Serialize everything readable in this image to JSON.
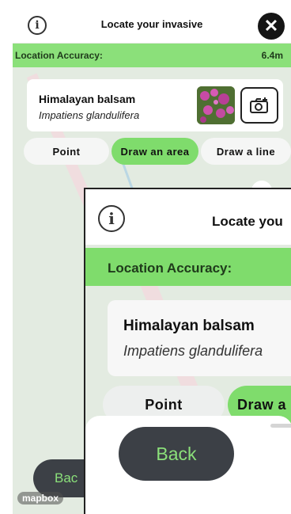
{
  "header": {
    "title": "Locate your invasive",
    "info_icon": "info-icon",
    "close_icon": "close-icon"
  },
  "accuracy": {
    "label": "Location Accuracy:",
    "value": "6.4m",
    "color": "#8be07a"
  },
  "species": {
    "common_name": "Himalayan balsam",
    "latin_name": "Impatiens glandulifera",
    "camera_icon": "camera-add-icon"
  },
  "modes": [
    {
      "label": "Point",
      "active": false
    },
    {
      "label": "Draw an area",
      "active": true
    },
    {
      "label": "Draw a line",
      "active": false
    }
  ],
  "footer": {
    "back_label": "Back",
    "attribution": "mapbox"
  },
  "inset": {
    "title": "Locate you",
    "accuracy_label": "Location Accuracy:",
    "common_name": "Himalayan balsam",
    "latin_name": "Impatiens glandulifera",
    "mode_point": "Point",
    "mode_active": "Draw a",
    "back_label": "Back",
    "small_back_label": "Bac"
  },
  "colors": {
    "accent": "#7fdc6c",
    "button_dark": "#3c4046",
    "map_bg": "#e3ebe1"
  }
}
